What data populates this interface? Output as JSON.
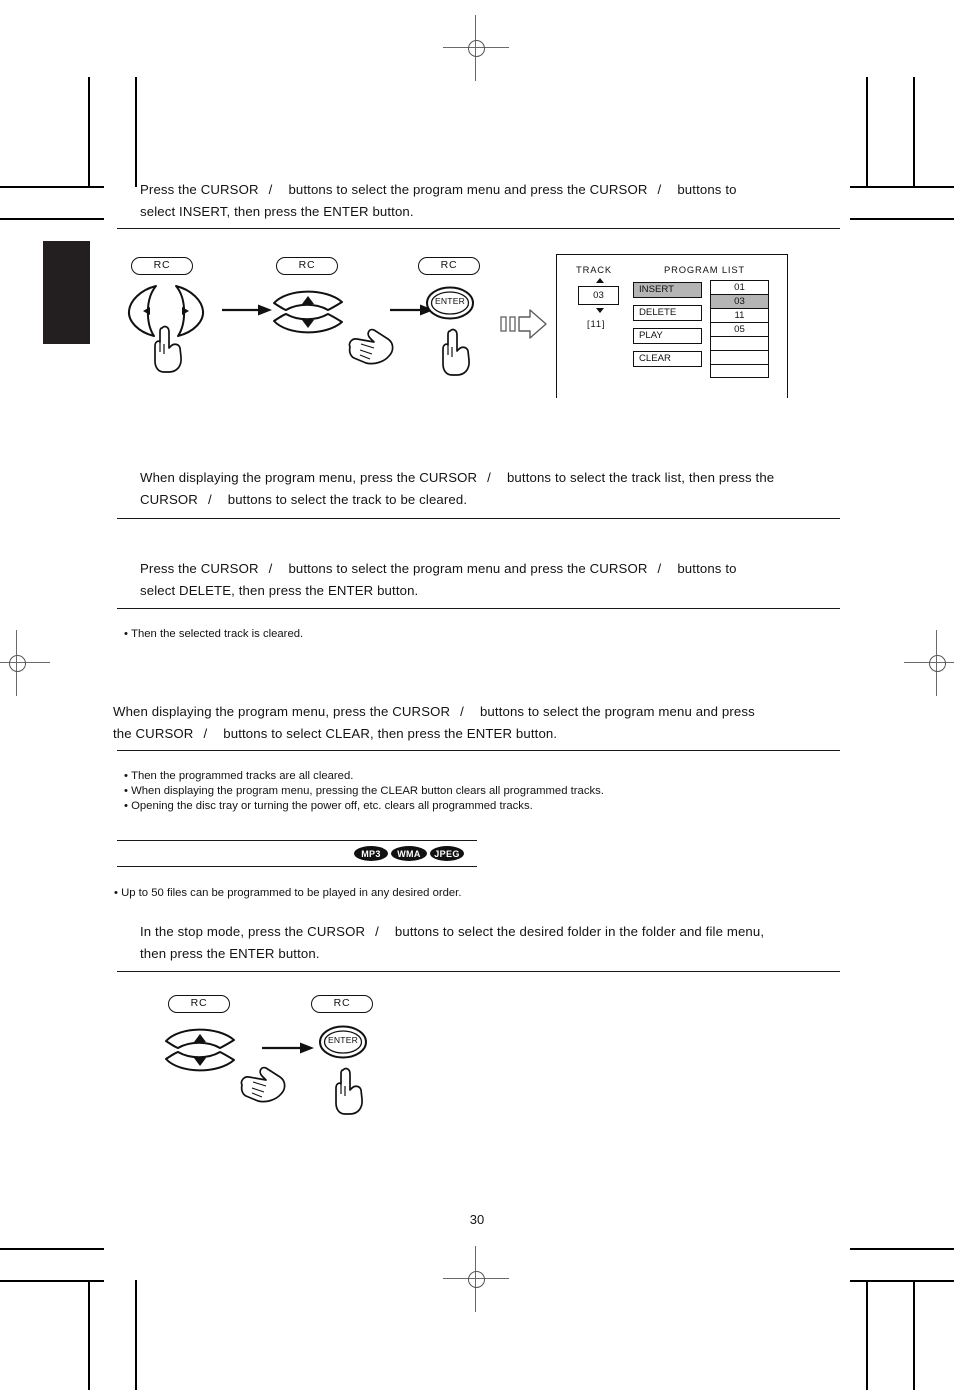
{
  "page": {
    "number": "30"
  },
  "steps": {
    "step1": {
      "line1_a": "Press the CURSOR",
      "line1_slash": "/",
      "line1_b": "buttons to select the program menu and press the CURSOR",
      "line1_slash2": "/",
      "line1_c": "buttons to",
      "line2": "select INSERT, then press the ENTER button."
    },
    "step2": {
      "line1_a": "When displaying the program menu, press the CURSOR",
      "line1_slash": "/",
      "line1_b": "buttons to select the track list, then press the",
      "line2_a": "CURSOR",
      "line2_slash": "/",
      "line2_b": "buttons to select the track to be cleared."
    },
    "step3": {
      "line1_a": "Press the CURSOR",
      "line1_slash": "/",
      "line1_b": "buttons to select the program menu and press the CURSOR",
      "line1_slash2": "/",
      "line1_c": "buttons to",
      "line2": "select DELETE, then press the ENTER button.",
      "note": "Then the selected track is cleared."
    },
    "step4": {
      "line1_a": "When displaying the program menu, press the CURSOR",
      "line1_slash": "/",
      "line1_b": "buttons to select the program menu and press",
      "line2_a": "the CURSOR",
      "line2_slash": "/",
      "line2_b": "buttons to select CLEAR, then press the ENTER button.",
      "notes": [
        "Then the programmed tracks are all cleared.",
        "When displaying the program menu, pressing the CLEAR button clears all programmed tracks.",
        "Opening the disc tray or turning the power off, etc. clears all programmed tracks."
      ]
    },
    "step5": {
      "note": "Up to 50 files can be programmed to be played in any desired order.",
      "line1_a": "In the stop mode, press the CURSOR",
      "line1_slash": "/",
      "line1_b": "buttons to select the desired folder in the folder and file menu,",
      "line2": "then press the ENTER button."
    }
  },
  "badges": [
    {
      "label": "MP3"
    },
    {
      "label": "WMA"
    },
    {
      "label": "JPEG"
    }
  ],
  "remote_diagram_top": {
    "rc_labels": [
      "RC",
      "RC",
      "RC"
    ],
    "enter_label": "ENTER"
  },
  "remote_diagram_bottom": {
    "rc_labels": [
      "RC",
      "RC"
    ],
    "enter_label": "ENTER"
  },
  "program_panel": {
    "track_label": "TRACK",
    "track_value": "03",
    "track_total": "[11]",
    "list_title": "PROGRAM LIST",
    "menu_items": [
      {
        "label": "INSERT",
        "selected": true
      },
      {
        "label": "DELETE",
        "selected": false
      },
      {
        "label": "PLAY",
        "selected": false
      },
      {
        "label": "CLEAR",
        "selected": false
      }
    ],
    "program_list": [
      {
        "value": "01",
        "selected": false
      },
      {
        "value": "03",
        "selected": true
      },
      {
        "value": "11",
        "selected": false
      },
      {
        "value": "05",
        "selected": false
      },
      {
        "value": "",
        "selected": false
      },
      {
        "value": "",
        "selected": false
      },
      {
        "value": "",
        "selected": false
      }
    ]
  },
  "colors": {
    "highlight": "#b5b5b5",
    "ink": "#111111",
    "tab": "#231f20"
  }
}
